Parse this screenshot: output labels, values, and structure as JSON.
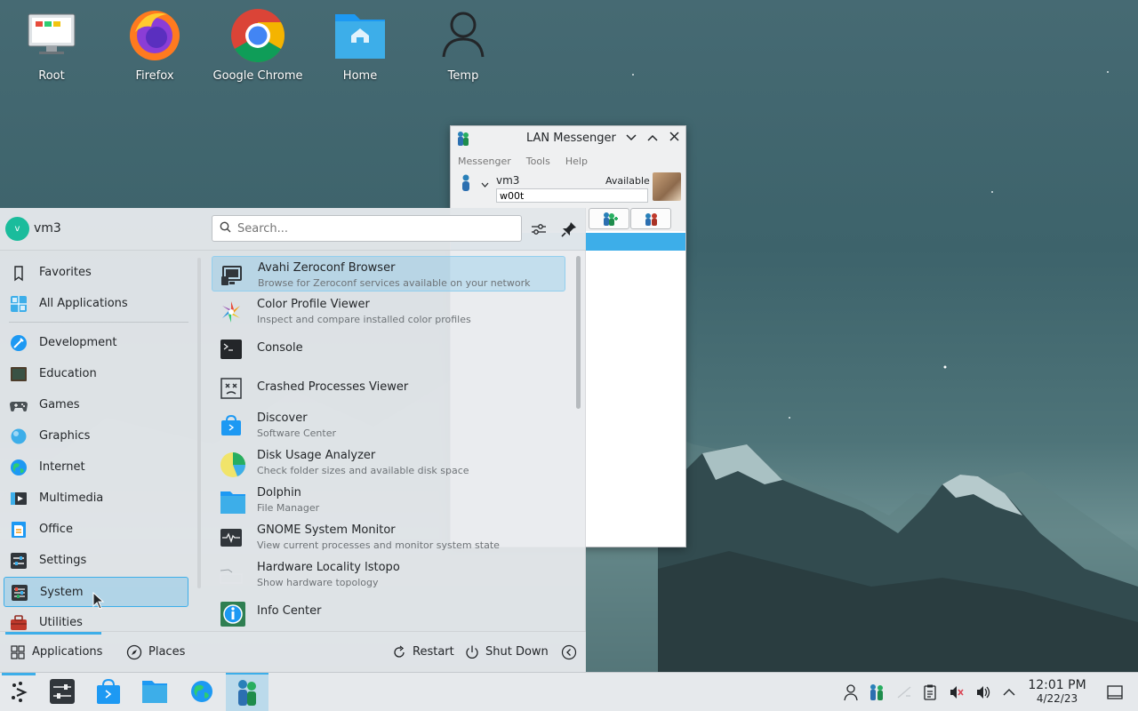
{
  "desktop": {
    "icons": [
      {
        "label": "Root",
        "icon": "computer-icon"
      },
      {
        "label": "Firefox",
        "icon": "firefox-icon"
      },
      {
        "label": "Google Chrome",
        "icon": "chrome-icon"
      },
      {
        "label": "Home",
        "icon": "home-folder-icon"
      },
      {
        "label": "Temp",
        "icon": "user-icon"
      }
    ]
  },
  "lan_messenger": {
    "title": "LAN Messenger",
    "menu": [
      "Messenger",
      "Tools",
      "Help"
    ],
    "user_name": "vm3",
    "availability": "Available",
    "status_message": "w00t"
  },
  "launcher": {
    "user": {
      "initial": "v",
      "name": "vm3"
    },
    "search_placeholder": "Search...",
    "categories": [
      {
        "label": "Favorites",
        "icon": "bookmark-icon"
      },
      {
        "label": "All Applications",
        "icon": "grid-icon"
      },
      {
        "label": "Development",
        "icon": "development-icon"
      },
      {
        "label": "Education",
        "icon": "education-icon"
      },
      {
        "label": "Games",
        "icon": "gamepad-icon"
      },
      {
        "label": "Graphics",
        "icon": "graphics-icon"
      },
      {
        "label": "Internet",
        "icon": "globe-icon"
      },
      {
        "label": "Multimedia",
        "icon": "multimedia-icon"
      },
      {
        "label": "Office",
        "icon": "office-icon"
      },
      {
        "label": "Settings",
        "icon": "settings-icon"
      },
      {
        "label": "System",
        "icon": "system-icon",
        "selected": true
      },
      {
        "label": "Utilities",
        "icon": "toolbox-icon"
      }
    ],
    "apps": [
      {
        "name": "Avahi Zeroconf Browser",
        "desc": "Browse for Zeroconf services available on your network",
        "selected": true
      },
      {
        "name": "Color Profile Viewer",
        "desc": "Inspect and compare installed color profiles"
      },
      {
        "name": "Console",
        "desc": ""
      },
      {
        "name": "Crashed Processes Viewer",
        "desc": ""
      },
      {
        "name": "Discover",
        "desc": "Software Center"
      },
      {
        "name": "Disk Usage Analyzer",
        "desc": "Check folder sizes and available disk space"
      },
      {
        "name": "Dolphin",
        "desc": "File Manager"
      },
      {
        "name": "GNOME System Monitor",
        "desc": "View current processes and monitor system state"
      },
      {
        "name": "Hardware Locality lstopo",
        "desc": "Show hardware topology"
      },
      {
        "name": "Info Center",
        "desc": ""
      }
    ],
    "footer": {
      "applications": "Applications",
      "places": "Places",
      "restart": "Restart",
      "shutdown": "Shut Down"
    }
  },
  "taskbar": {
    "time": "12:01 PM",
    "date": "4/22/23"
  },
  "colors": {
    "accent": "#3daee9",
    "panel": "#e6e9ec"
  }
}
